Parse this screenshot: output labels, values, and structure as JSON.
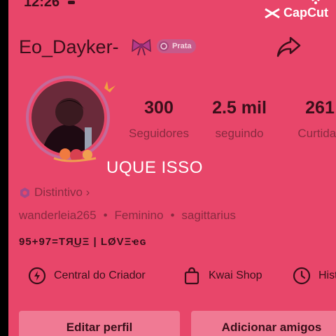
{
  "status_bar": {
    "time": "12:26"
  },
  "watermark": {
    "label": "CapCut"
  },
  "profile": {
    "username": "Eo_Dayker-",
    "badge_label": "Prata",
    "stats": [
      {
        "value": "300",
        "label": "Seguidores"
      },
      {
        "value": "2.5 mil",
        "label": "seguindo"
      },
      {
        "value": "261",
        "label": "Curtidas"
      }
    ],
    "distintivo": "Distintivo ›",
    "info": [
      "wanderleia265",
      "•",
      "Feminino",
      "•",
      "sagittarius"
    ],
    "bio": "95+97=TЯ͜UΞ | LØVΞҽɢ"
  },
  "overlay": {
    "caption": "UQUE ISSO"
  },
  "shortcuts": [
    {
      "label": "Central do Criador",
      "icon": "lightning-circle-icon"
    },
    {
      "label": "Kwai Shop",
      "icon": "shopping-bag-icon"
    },
    {
      "label": "Histó",
      "icon": "clock-icon"
    }
  ],
  "buttons": {
    "edit_profile": "Editar perfil",
    "add_friends": "Adicionar amigos"
  },
  "colors": {
    "background": "#e8466a",
    "text_dark": "#3a0f1a",
    "text_muted": "#8a2a40",
    "button_bg": "#f07a94",
    "badge_bg": "#c65a8a"
  }
}
